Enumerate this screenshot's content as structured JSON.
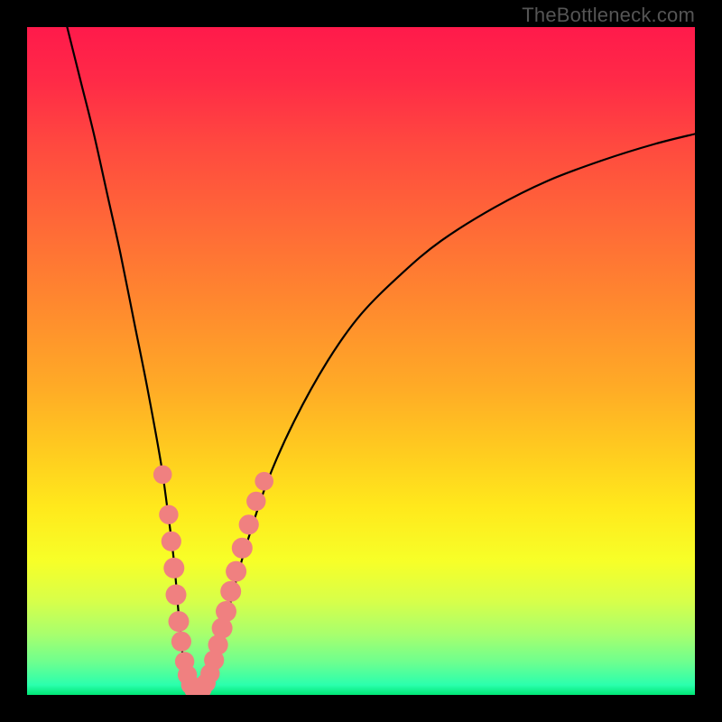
{
  "watermark": "TheBottleneck.com",
  "gradient_stops": [
    {
      "offset": 0.0,
      "color": "#ff1a4b"
    },
    {
      "offset": 0.08,
      "color": "#ff2a47"
    },
    {
      "offset": 0.18,
      "color": "#ff4a3f"
    },
    {
      "offset": 0.3,
      "color": "#ff6a37"
    },
    {
      "offset": 0.42,
      "color": "#ff8a2e"
    },
    {
      "offset": 0.54,
      "color": "#ffab26"
    },
    {
      "offset": 0.64,
      "color": "#ffcd1f"
    },
    {
      "offset": 0.72,
      "color": "#ffe91c"
    },
    {
      "offset": 0.8,
      "color": "#f7ff28"
    },
    {
      "offset": 0.86,
      "color": "#d7ff4a"
    },
    {
      "offset": 0.91,
      "color": "#a7ff6e"
    },
    {
      "offset": 0.95,
      "color": "#6fff8e"
    },
    {
      "offset": 0.985,
      "color": "#2bffad"
    },
    {
      "offset": 1.0,
      "color": "#00e676"
    }
  ],
  "chart_data": {
    "type": "line",
    "title": "",
    "xlabel": "",
    "ylabel": "",
    "xlim": [
      0,
      100
    ],
    "ylim": [
      0,
      100
    ],
    "series": [
      {
        "name": "bottleneck-curve",
        "x": [
          6,
          8,
          10,
          12,
          14,
          16,
          18,
          20,
          21,
          22,
          22.7,
          23.3,
          24,
          25,
          26,
          27,
          28,
          29.5,
          31,
          33,
          36,
          40,
          45,
          50,
          56,
          62,
          70,
          78,
          86,
          94,
          100
        ],
        "y": [
          100,
          92,
          84,
          75,
          66,
          56,
          46,
          35,
          28,
          20,
          12,
          6,
          1.5,
          0,
          0,
          1.5,
          5,
          10,
          16,
          23,
          32,
          41,
          50,
          57,
          63,
          68,
          73,
          77,
          80,
          82.5,
          84
        ]
      }
    ],
    "markers": [
      {
        "name": "dots",
        "color": "#f08080",
        "points": [
          {
            "x": 20.3,
            "y": 33,
            "r": 1.3
          },
          {
            "x": 21.2,
            "y": 27,
            "r": 1.4
          },
          {
            "x": 21.6,
            "y": 23,
            "r": 1.5
          },
          {
            "x": 22.0,
            "y": 19,
            "r": 1.6
          },
          {
            "x": 22.3,
            "y": 15,
            "r": 1.6
          },
          {
            "x": 22.7,
            "y": 11,
            "r": 1.6
          },
          {
            "x": 23.1,
            "y": 8,
            "r": 1.5
          },
          {
            "x": 23.6,
            "y": 5,
            "r": 1.4
          },
          {
            "x": 24.0,
            "y": 3,
            "r": 1.4
          },
          {
            "x": 24.5,
            "y": 1.5,
            "r": 1.4
          },
          {
            "x": 25.0,
            "y": 0.8,
            "r": 1.4
          },
          {
            "x": 25.6,
            "y": 0.6,
            "r": 1.4
          },
          {
            "x": 26.2,
            "y": 0.9,
            "r": 1.4
          },
          {
            "x": 26.8,
            "y": 1.8,
            "r": 1.4
          },
          {
            "x": 27.4,
            "y": 3.2,
            "r": 1.4
          },
          {
            "x": 28.0,
            "y": 5.2,
            "r": 1.5
          },
          {
            "x": 28.6,
            "y": 7.5,
            "r": 1.5
          },
          {
            "x": 29.2,
            "y": 10,
            "r": 1.6
          },
          {
            "x": 29.8,
            "y": 12.5,
            "r": 1.6
          },
          {
            "x": 30.5,
            "y": 15.5,
            "r": 1.6
          },
          {
            "x": 31.3,
            "y": 18.5,
            "r": 1.6
          },
          {
            "x": 32.2,
            "y": 22,
            "r": 1.6
          },
          {
            "x": 33.2,
            "y": 25.5,
            "r": 1.5
          },
          {
            "x": 34.3,
            "y": 29,
            "r": 1.4
          },
          {
            "x": 35.5,
            "y": 32,
            "r": 1.3
          }
        ]
      }
    ],
    "notes": "y is bottleneck percent (0 at bottom, 100 at top); x is relative performance axis. Values estimated from pixels; the lighter pink segments near the valley are represented as marker dots along the curve."
  }
}
